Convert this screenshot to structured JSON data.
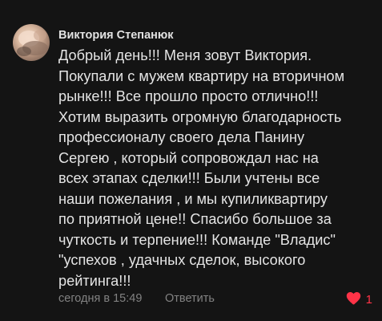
{
  "comment": {
    "author": "Виктория Степанюк",
    "text_lines": [
      "Добрый день!!! Меня зовут Виктория.",
      "Покупали с мужем квартиру на вторичном",
      "рынке!!! Все прошло просто отлично!!!",
      "Хотим выразить огромную благодарность",
      "профессионалу своего дела Панину",
      "Сергею , который сопровождал нас на",
      "всех этапах сделки!!! Были учтены все",
      "наши пожелания , и мы купиликвартиру",
      "по приятной цене!! Спасибо большое за",
      "чуткость и терпение!!! Команде \"Владис\"",
      "\"успехов , удачных сделок, высокого",
      "рейтинга!!!"
    ],
    "timestamp": "сегодня в 15:49",
    "reply_label": "Ответить",
    "like_count": "1",
    "like_icon": "heart-icon",
    "like_color": "#ff3347",
    "background": "#141414"
  }
}
